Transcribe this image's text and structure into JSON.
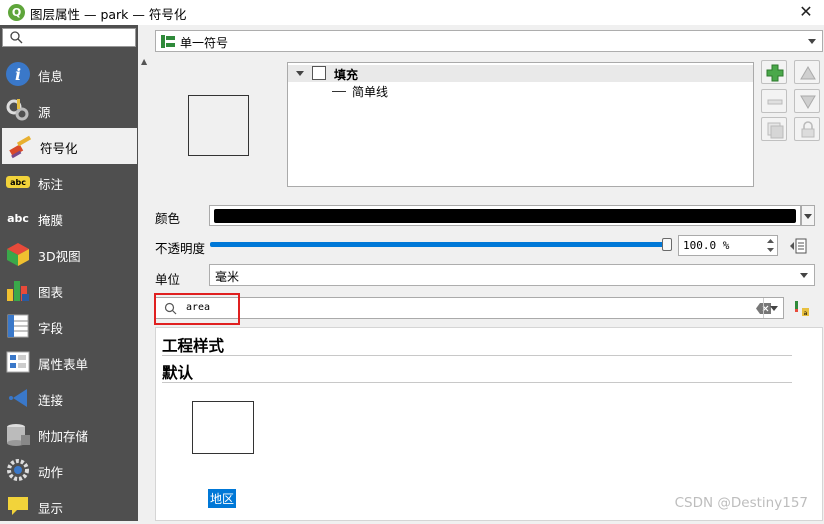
{
  "window": {
    "app_icon": "qgis-icon",
    "title": "图层属性 — park — 符号化",
    "close_glyph": "✕"
  },
  "sidebar": {
    "search_placeholder": "",
    "items": [
      {
        "label": "信息",
        "icon": "info-icon",
        "active": false
      },
      {
        "label": "源",
        "icon": "source-icon",
        "active": false
      },
      {
        "label": "符号化",
        "icon": "symbology-icon",
        "active": true
      },
      {
        "label": "标注",
        "icon": "labels-icon",
        "active": false
      },
      {
        "label": "掩膜",
        "icon": "mask-icon",
        "active": false
      },
      {
        "label": "3D视图",
        "icon": "3d-view-icon",
        "active": false
      },
      {
        "label": "图表",
        "icon": "diagrams-icon",
        "active": false
      },
      {
        "label": "字段",
        "icon": "fields-icon",
        "active": false
      },
      {
        "label": "属性表单",
        "icon": "attributes-form-icon",
        "active": false
      },
      {
        "label": "连接",
        "icon": "joins-icon",
        "active": false
      },
      {
        "label": "附加存储",
        "icon": "auxiliary-storage-icon",
        "active": false
      },
      {
        "label": "动作",
        "icon": "actions-icon",
        "active": false
      },
      {
        "label": "显示",
        "icon": "display-icon",
        "active": false
      }
    ]
  },
  "renderer": {
    "selected": "单一符号"
  },
  "symbol_tree": {
    "fill_label": "填充",
    "simple_line_label": "简单线"
  },
  "properties": {
    "color_label": "颜色",
    "color_value": "#000000",
    "opacity_label": "不透明度",
    "opacity_value": "100.0 %",
    "opacity_fraction": 1.0,
    "unit_label": "单位",
    "unit_value": "毫米"
  },
  "style_search": {
    "query": "area"
  },
  "symbol_library": {
    "groups": [
      "工程样式",
      "默认"
    ],
    "symbols": [
      {
        "name": "地区"
      }
    ]
  },
  "watermark": "CSDN @Destiny157",
  "colors": {
    "sidebar_bg": "#4f4f4f",
    "accent": "#0078d7",
    "highlight_box": "#e02020"
  }
}
